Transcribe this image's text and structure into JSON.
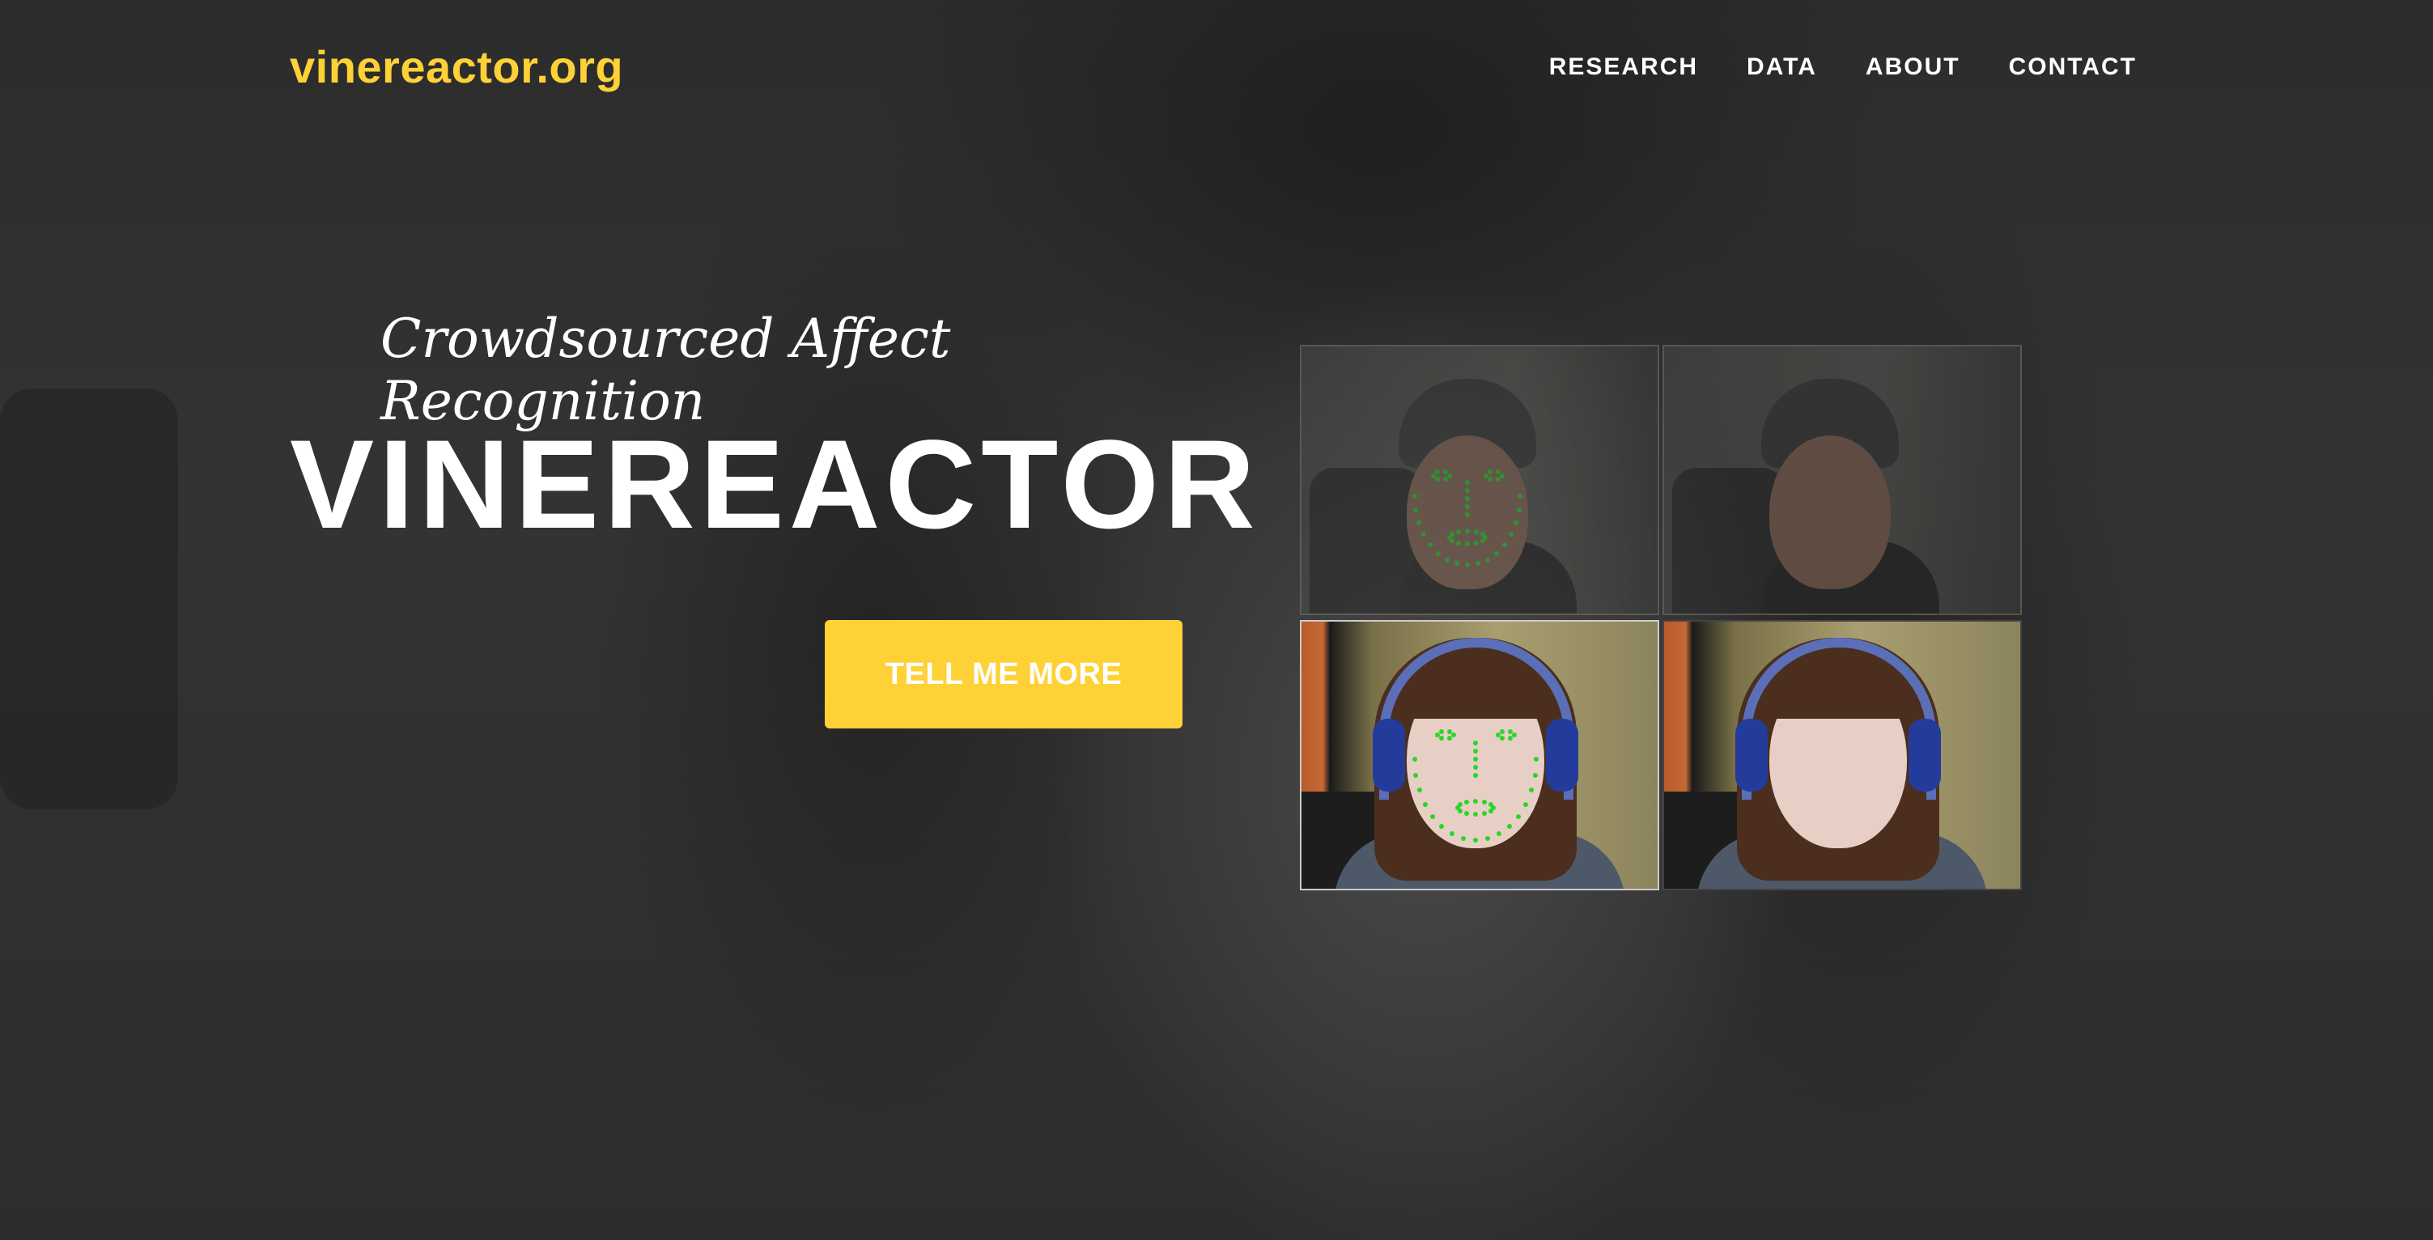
{
  "brand": {
    "text": "vinereactor.org",
    "color": "#fed136"
  },
  "nav": {
    "items": [
      {
        "label": "RESEARCH"
      },
      {
        "label": "DATA"
      },
      {
        "label": "ABOUT"
      },
      {
        "label": "CONTACT"
      }
    ]
  },
  "hero": {
    "subtitle": "Crowdsourced Affect Recognition",
    "title": "VINEREACTOR",
    "cta_label": "TELL ME MORE"
  },
  "gallery": {
    "tiles": [
      {
        "subject": "man-with-beanie",
        "landmarks_overlay": true
      },
      {
        "subject": "man-with-beanie",
        "landmarks_overlay": false
      },
      {
        "subject": "woman-with-headphones",
        "landmarks_overlay": true
      },
      {
        "subject": "woman-with-headphones",
        "landmarks_overlay": false
      }
    ]
  },
  "colors": {
    "accent": "#fed136",
    "landmark": "#29d62c",
    "background": "#2a2a2a"
  }
}
